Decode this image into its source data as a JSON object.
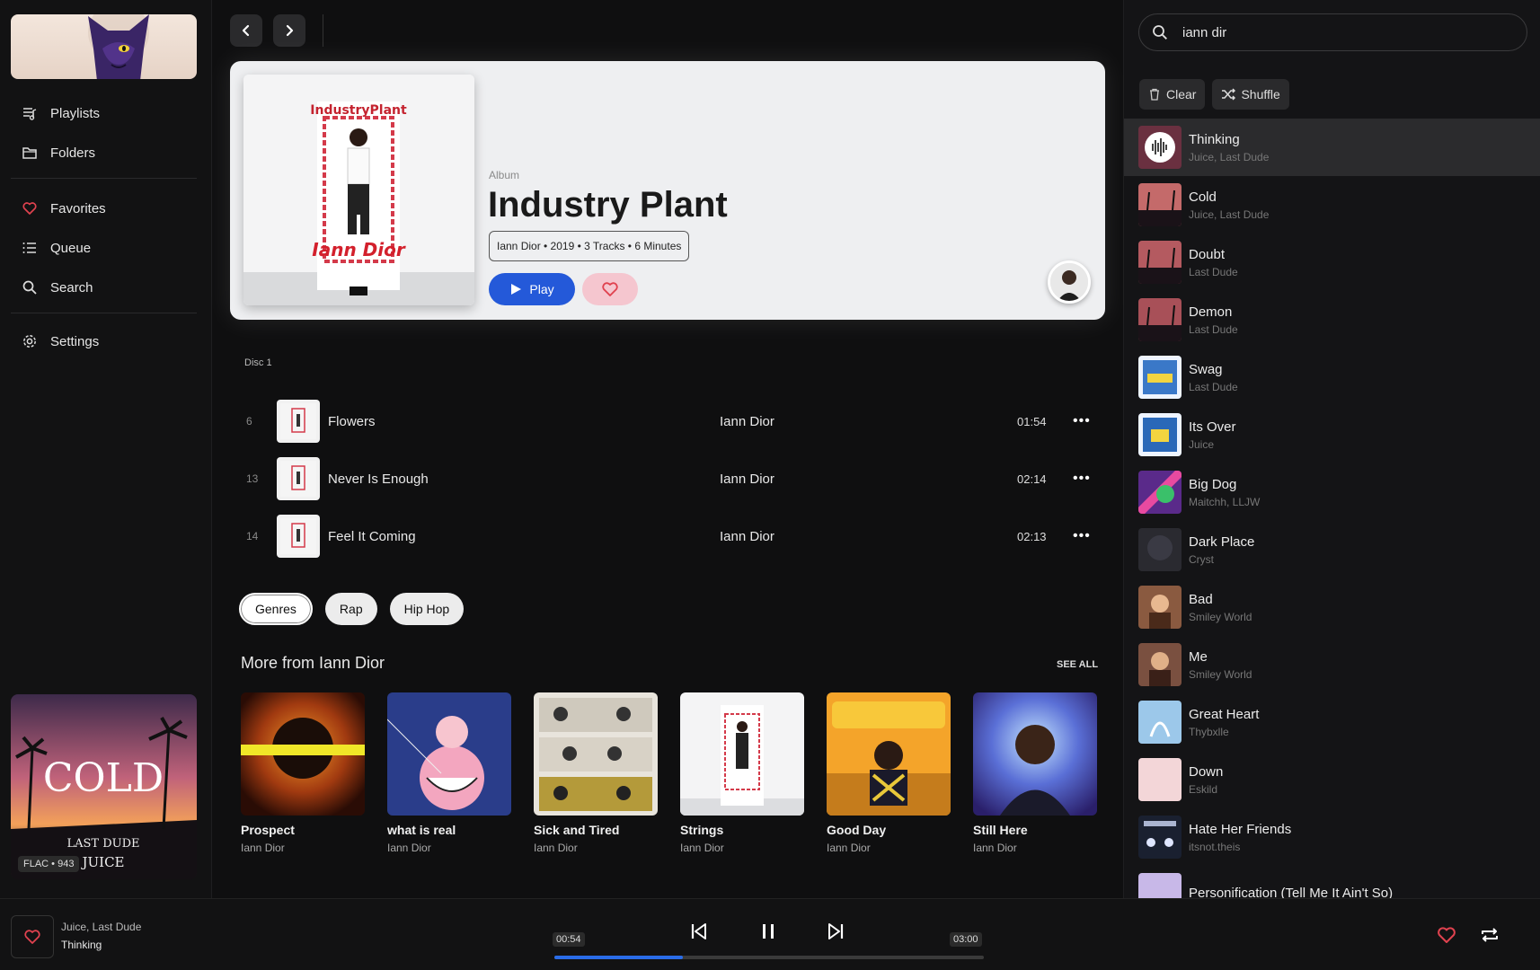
{
  "sidebar": {
    "nav": [
      {
        "label": "Playlists",
        "icon": "playlist-icon"
      },
      {
        "label": "Folders",
        "icon": "folder-icon"
      },
      {
        "label": "Favorites",
        "icon": "heart-icon"
      },
      {
        "label": "Queue",
        "icon": "queue-icon"
      },
      {
        "label": "Search",
        "icon": "search-icon"
      },
      {
        "label": "Settings",
        "icon": "gear-icon"
      }
    ],
    "now_playing_badge": "FLAC • 943",
    "now_playing_art_text": "COLD",
    "now_playing_art_sub1": "LAST DUDE",
    "now_playing_art_sub2": "JUICE"
  },
  "album": {
    "type": "Album",
    "title": "Industry Plant",
    "meta": "Iann Dior • 2019 • 3 Tracks • 6 Minutes",
    "play_label": "Play",
    "art_text": "IndustryPlant"
  },
  "disc_label": "Disc 1",
  "tracks": [
    {
      "num": "6",
      "title": "Flowers",
      "artist": "Iann Dior",
      "duration": "01:54"
    },
    {
      "num": "13",
      "title": "Never Is Enough",
      "artist": "Iann Dior",
      "duration": "02:14"
    },
    {
      "num": "14",
      "title": "Feel It Coming",
      "artist": "Iann Dior",
      "duration": "02:13"
    }
  ],
  "genres": {
    "label": "Genres",
    "items": [
      "Rap",
      "Hip Hop"
    ]
  },
  "more_from": {
    "title": "More from Iann Dior",
    "see_all": "SEE ALL",
    "albums": [
      {
        "name": "Prospect",
        "artist": "Iann Dior"
      },
      {
        "name": "what is real",
        "artist": "Iann Dior"
      },
      {
        "name": "Sick and Tired",
        "artist": "Iann Dior"
      },
      {
        "name": "Strings",
        "artist": "Iann Dior"
      },
      {
        "name": "Good Day",
        "artist": "Iann Dior"
      },
      {
        "name": "Still Here",
        "artist": "Iann Dior"
      }
    ]
  },
  "right_panel": {
    "search_value": "iann dir",
    "clear_label": "Clear",
    "shuffle_label": "Shuffle",
    "queue": [
      {
        "title": "Thinking",
        "artist": "Juice, Last Dude"
      },
      {
        "title": "Cold",
        "artist": "Juice, Last Dude"
      },
      {
        "title": "Doubt",
        "artist": "Last Dude"
      },
      {
        "title": "Demon",
        "artist": "Last Dude"
      },
      {
        "title": "Swag",
        "artist": "Last Dude"
      },
      {
        "title": "Its Over",
        "artist": "Juice"
      },
      {
        "title": "Big Dog",
        "artist": "Maitchh, LLJW"
      },
      {
        "title": "Dark Place",
        "artist": "Cryst"
      },
      {
        "title": "Bad",
        "artist": "Smiley World"
      },
      {
        "title": "Me",
        "artist": "Smiley World"
      },
      {
        "title": "Great Heart",
        "artist": "Thybxlle"
      },
      {
        "title": "Down",
        "artist": "Eskild"
      },
      {
        "title": "Hate Her Friends",
        "artist": "itsnot.theis"
      },
      {
        "title": "Personification (Tell Me It Ain't So)",
        "artist": ""
      }
    ]
  },
  "player": {
    "artist": "Juice, Last Dude",
    "title": "Thinking",
    "elapsed": "00:54",
    "total": "03:00",
    "progress_fraction": 0.3
  },
  "colors": {
    "accent": "#2459d9",
    "heart": "#e0424f",
    "background": "#0f0f10"
  }
}
